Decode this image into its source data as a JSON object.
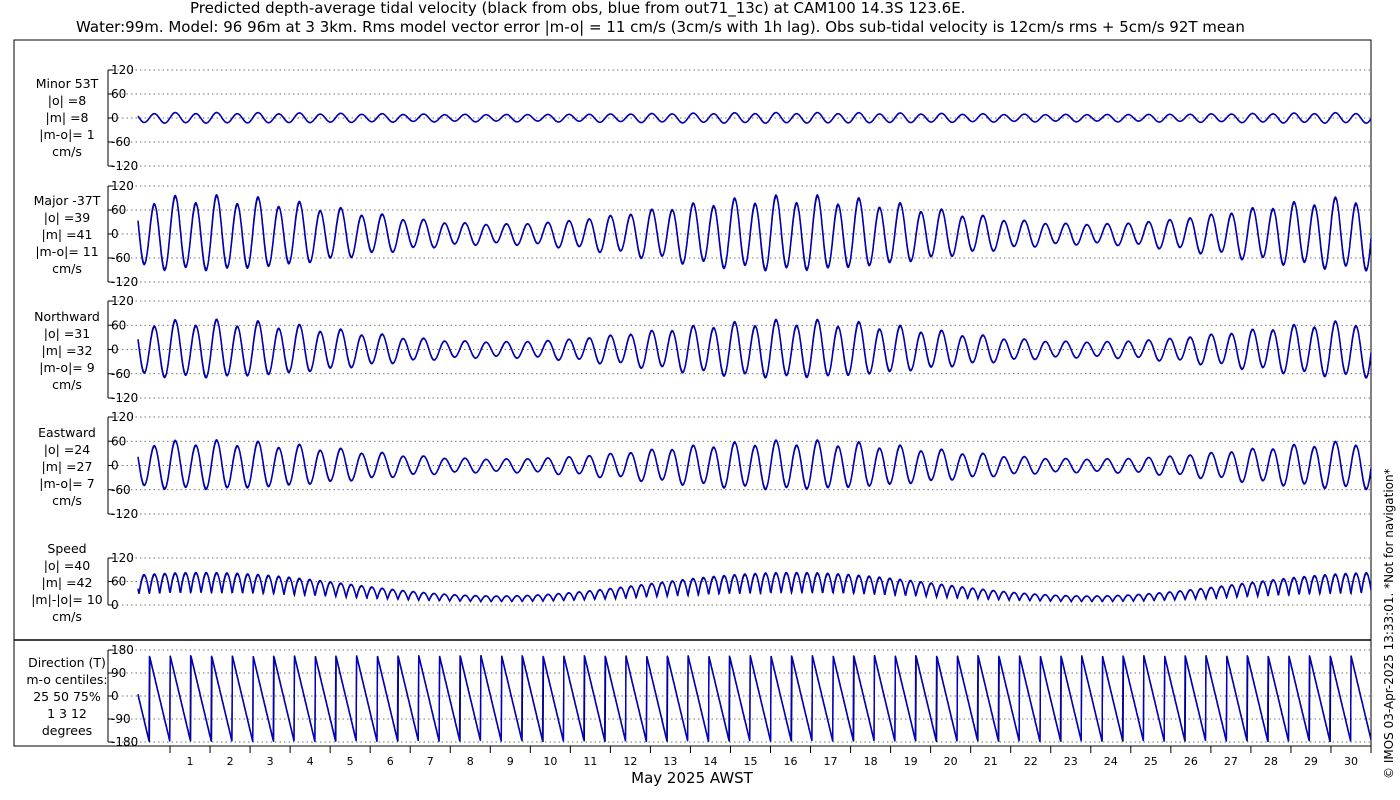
{
  "title": {
    "line1": "Predicted depth-average tidal velocity (black from obs, blue from out71_13c) at CAM100 14.3S 123.6E.",
    "line2": "Water:99m. Model: 96 96m at 3 3km. Rms model vector error |m-o| = 11 cm/s (3cm/s with 1h lag). Obs sub-tidal velocity is 12cm/s rms + 5cm/s 92T mean"
  },
  "credit": "© IMOS 03-Apr-2025 13:33:01. *Not for navigation*",
  "colors": {
    "obs": "#000000",
    "model": "#0000cc",
    "grid": "#444444",
    "axis": "#000000"
  },
  "chart_data": {
    "type": "line",
    "xlabel": "May 2025 AWST",
    "x_ticks": [
      "1",
      "2",
      "3",
      "4",
      "5",
      "6",
      "7",
      "8",
      "9",
      "10",
      "11",
      "12",
      "13",
      "14",
      "15",
      "16",
      "17",
      "18",
      "19",
      "20",
      "21",
      "22",
      "23",
      "24",
      "25",
      "26",
      "27",
      "28",
      "29",
      "30"
    ],
    "x_range_days": [
      0.2,
      31.0
    ],
    "series_names": [
      "obs",
      "model"
    ],
    "panels": [
      {
        "id": "minor",
        "label_lines": [
          "Minor 53T",
          "|o| =8",
          "|m| =8",
          "|m-o|= 1",
          "cm/s"
        ],
        "ylim": [
          -120,
          120
        ],
        "yticks": [
          "120",
          "60",
          "0",
          "-60",
          "-120"
        ],
        "ytick_values": [
          120,
          60,
          0,
          -60,
          -120
        ],
        "kind": "oscillation",
        "amplitude_cm_s": 12,
        "spring_neap_modulation": 0.3
      },
      {
        "id": "major",
        "label_lines": [
          "Major -37T",
          "|o| =39",
          "|m| =41",
          "|m-o|= 11",
          "cm/s"
        ],
        "ylim": [
          -120,
          120
        ],
        "yticks": [
          "120",
          "60",
          "0",
          "-60",
          "-120"
        ],
        "ytick_values": [
          120,
          60,
          0,
          -60,
          -120
        ],
        "kind": "oscillation",
        "amplitude_cm_s": 85,
        "spring_neap_modulation": 0.72
      },
      {
        "id": "northward",
        "label_lines": [
          "Northward",
          "|o| =31",
          "|m| =32",
          "|m-o|= 9",
          "cm/s"
        ],
        "ylim": [
          -120,
          120
        ],
        "yticks": [
          "120",
          "60",
          "0",
          "-60",
          "-120"
        ],
        "ytick_values": [
          120,
          60,
          0,
          -60,
          -120
        ],
        "kind": "oscillation",
        "amplitude_cm_s": 65,
        "spring_neap_modulation": 0.72
      },
      {
        "id": "eastward",
        "label_lines": [
          "Eastward",
          "|o| =24",
          "|m| =27",
          "|m-o|= 7",
          "cm/s"
        ],
        "ylim": [
          -120,
          120
        ],
        "yticks": [
          "120",
          "60",
          "0",
          "-60",
          "-120"
        ],
        "ytick_values": [
          120,
          60,
          0,
          -60,
          -120
        ],
        "kind": "oscillation",
        "amplitude_cm_s": 55,
        "spring_neap_modulation": 0.72
      },
      {
        "id": "speed",
        "label_lines": [
          "Speed",
          "|o| =40",
          "|m| =42",
          "|m|-|o|= 10",
          "cm/s"
        ],
        "ylim": [
          0,
          120
        ],
        "yticks": [
          "120",
          "60",
          "0"
        ],
        "ytick_values": [
          120,
          60,
          0
        ],
        "kind": "speed",
        "amplitude_cm_s": 85,
        "spring_neap_modulation": 0.72
      },
      {
        "id": "direction",
        "label_lines": [
          "Direction (T)",
          "m-o centiles:",
          "25  50  75%",
          "1   3  12",
          "degrees"
        ],
        "ylim": [
          -180,
          180
        ],
        "yticks": [
          "180",
          "90",
          "0",
          "-90",
          "-180"
        ],
        "ytick_values": [
          180,
          90,
          0,
          -90,
          -180
        ],
        "kind": "direction"
      }
    ]
  }
}
